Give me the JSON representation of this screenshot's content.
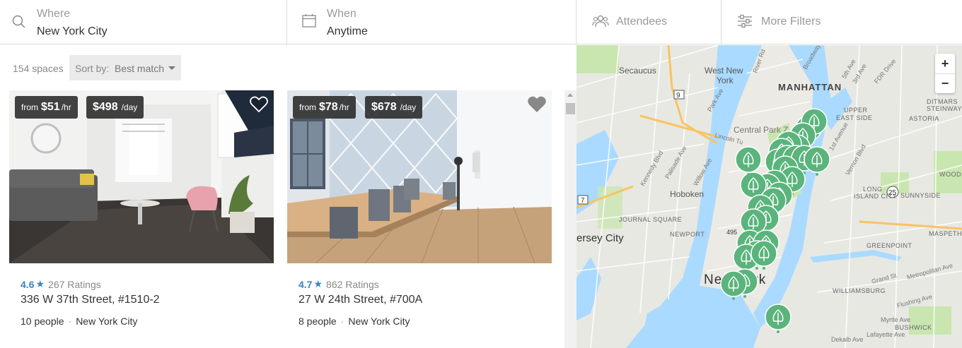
{
  "search": {
    "where": {
      "label": "Where",
      "value": "New York City"
    },
    "when": {
      "label": "When",
      "value": "Anytime"
    },
    "attendees_label": "Attendees",
    "more_filters_label": "More Filters"
  },
  "results": {
    "count_text": "154 spaces",
    "sort_label": "Sort by:",
    "sort_value": "Best match"
  },
  "listings": [
    {
      "price_from": "from",
      "price_hourly": "$51",
      "hourly_unit": "/hr",
      "price_daily": "$498",
      "daily_unit": "/day",
      "rating": "4.6",
      "ratings_count": "267 Ratings",
      "address": "336 W 37th Street, #1510-2",
      "capacity": "10 people",
      "dot": "·",
      "city": "New York City"
    },
    {
      "price_from": "from",
      "price_hourly": "$78",
      "hourly_unit": "/hr",
      "price_daily": "$678",
      "daily_unit": "/day",
      "rating": "4.7",
      "ratings_count": "862 Ratings",
      "address": "27 W 24th Street, #700A",
      "capacity": "8 people",
      "dot": "·",
      "city": "New York City"
    }
  ],
  "map": {
    "zoom_in": "+",
    "zoom_out": "−",
    "labels": {
      "secaucus": "Secaucus",
      "west_new_york_1": "West New",
      "west_new_york_2": "York",
      "manhattan": "MANHATTAN",
      "upper_east_side_1": "UPPER",
      "upper_east_side_2": "EAST SIDE",
      "central_park": "Central Park Z",
      "hoboken": "Hoboken",
      "jersey_city": "ersey City",
      "journal_square": "JOURNAL SQUARE",
      "newport": "NEWPORT",
      "new_york": "New York",
      "astoria": "ASTORIA",
      "ditmars_1": "DITMARS",
      "ditmars_2": "STEINWAY",
      "long_island_city_1": "LONG",
      "long_island_city_2": "ISLAND CITY",
      "sunnyside": "SUNNYSIDE",
      "woods": "WOODS",
      "maspeth": "MASPETH",
      "greenpoint": "GREENPOINT",
      "williamsburg": "WILLIAMSBURG",
      "bushwick": "BUSHWICK",
      "lincoln_tunnel": "Lincoln Tu",
      "fdr_drive": "FDR Drive",
      "broadway": "Broadway",
      "fifth_ave": "5th Ave",
      "third_ave": "3rd Ave",
      "first_ave": "1st Avenue",
      "river_rd": "River Rd",
      "kennedy_blvd": "Kennedy Blvd",
      "park_ave": "Park Ave",
      "willow_ave": "Willow Ave",
      "palisade_ave": "Palisade Ave",
      "grand_st": "Grand St",
      "metropolitan_ave": "Metropolitan Ave",
      "flushing_ave": "Flushing Ave",
      "myrtle_ave": "Myrtle Ave",
      "dekalb_ave": "Dekalb Ave",
      "lafayette_ave": "Lafayette Ave",
      "vernon_blvd": "Vernon Blvd",
      "route_9": "9",
      "route_7": "7",
      "route_25": "25",
      "route_495": "495"
    },
    "colors": {
      "water": "#aadaff",
      "land": "#e8e8e3",
      "park": "#c9e6b0",
      "pin": "#5ab47c",
      "road": "#ffffff",
      "highway": "#f8c460"
    }
  },
  "icons": [
    "search-icon",
    "calendar-icon",
    "people-icon",
    "sliders-icon",
    "heart-icon",
    "star-icon",
    "tree-pin-icon"
  ]
}
